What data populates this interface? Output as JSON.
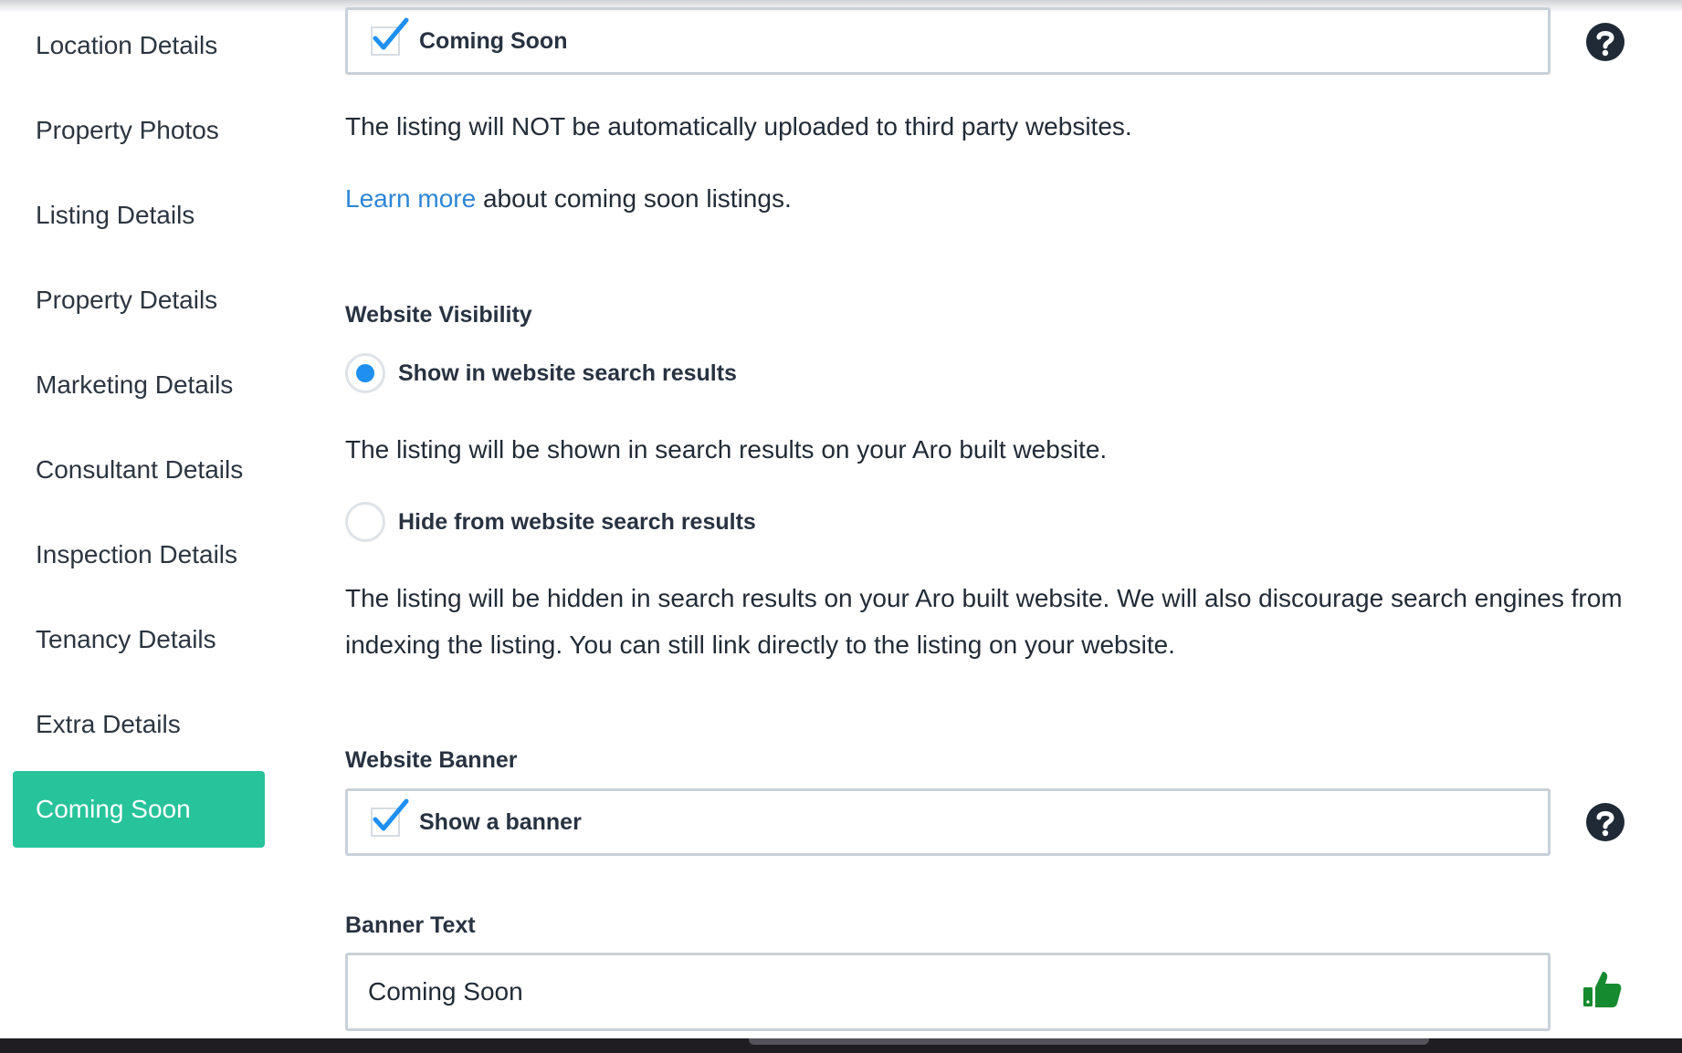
{
  "sidebar": {
    "items": [
      {
        "label": "Location Details"
      },
      {
        "label": "Property Photos"
      },
      {
        "label": "Listing Details"
      },
      {
        "label": "Property Details"
      },
      {
        "label": "Marketing Details"
      },
      {
        "label": "Consultant Details"
      },
      {
        "label": "Inspection Details"
      },
      {
        "label": "Tenancy Details"
      },
      {
        "label": "Extra Details"
      },
      {
        "label": "Coming Soon"
      }
    ],
    "active": "Coming Soon"
  },
  "coming_soon": {
    "checkbox_label": "Coming Soon",
    "checked": true,
    "note": "The listing will NOT be automatically uploaded to third party websites.",
    "learn_more_link": "Learn more",
    "learn_more_rest": " about coming soon listings."
  },
  "website_visibility": {
    "heading": "Website Visibility",
    "options": [
      {
        "label": "Show in website search results",
        "selected": true,
        "description": "The listing will be shown in search results on your Aro built website."
      },
      {
        "label": "Hide from website search results",
        "selected": false,
        "description": "The listing will be hidden in search results on your Aro built website. We will also discourage search engines from indexing the listing. You can still link directly to the listing on your website."
      }
    ]
  },
  "website_banner": {
    "heading": "Website Banner",
    "checkbox_label": "Show a banner",
    "checked": true
  },
  "banner_text": {
    "heading": "Banner Text",
    "value": "Coming Soon"
  },
  "colors": {
    "accent": "#27c39b",
    "link": "#2e86d6",
    "check": "#1f8ff0",
    "thumb": "#168a2e"
  },
  "icons": [
    "help-icon",
    "thumbs-up-icon",
    "checkmark-icon"
  ]
}
